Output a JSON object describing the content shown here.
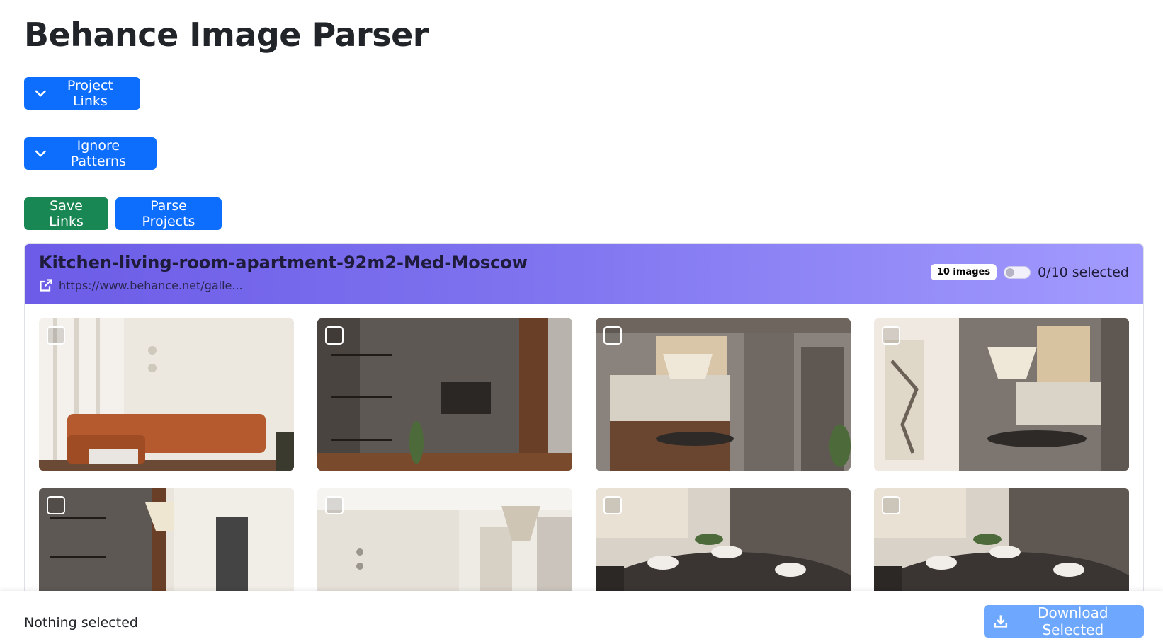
{
  "page": {
    "title": "Behance Image Parser"
  },
  "controls": {
    "project_links_label": "Project Links",
    "ignore_patterns_label": "Ignore Patterns",
    "save_links_label": "Save Links",
    "parse_projects_label": "Parse Projects"
  },
  "project": {
    "title": "Kitchen-living-room-apartment-92m2-Med-Moscow",
    "link_text": "https://www.behance.net/galle...",
    "images_badge": "10 images",
    "selected_text": "0/10 selected",
    "toggle_on": false,
    "images": [
      {
        "scene": "living-room-orange-sofa",
        "selected": false
      },
      {
        "scene": "tv-wall-shelves",
        "selected": false
      },
      {
        "scene": "kitchen-chandelier",
        "selected": false
      },
      {
        "scene": "dining-art-chandelier",
        "selected": false
      },
      {
        "scene": "living-room-chandelier",
        "selected": false
      },
      {
        "scene": "hallway-light",
        "selected": false
      },
      {
        "scene": "dining-table-closeup",
        "selected": false
      },
      {
        "scene": "dining-table-closeup-2",
        "selected": false
      }
    ]
  },
  "footer": {
    "status": "Nothing selected",
    "download_label": "Download Selected"
  },
  "colors": {
    "primary": "#0d6efd",
    "success": "#198754",
    "header_gradient_start": "#6c5ce7",
    "header_gradient_end": "#a29bfe",
    "download_disabled": "#6ea8fe"
  }
}
